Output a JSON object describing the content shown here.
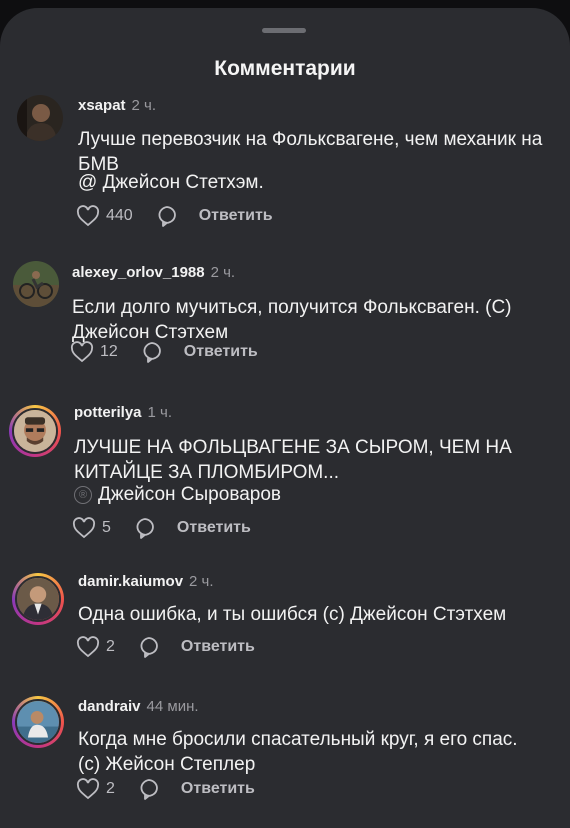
{
  "header": {
    "title": "Комментарии"
  },
  "comments": [
    {
      "username": "xsapat",
      "time": "2 ч.",
      "text": "Лучше перевозчик на Фольксвагене, чем механик на БМВ",
      "mention": "@ Джейсон Стетхэм.",
      "likes": "440",
      "reply": "Ответить"
    },
    {
      "username": "alexey_orlov_1988",
      "time": "2 ч.",
      "text": "Если долго мучиться, получится Фольксваген. (С) Джейсон Стэтхем",
      "likes": "12",
      "reply": "Ответить"
    },
    {
      "username": "potterilya",
      "time": "1 ч.",
      "text": "ЛУЧШЕ НА ФОЛЬЦВАГЕНЕ ЗА СЫРОМ, ЧЕМ НА КИТАЙЦЕ ЗА ПЛОМБИРОМ...",
      "mention": "Джейсон Сыроваров",
      "mention_symbol": "®",
      "likes": "5",
      "reply": "Ответить"
    },
    {
      "username": "damir.kaiumov",
      "time": "2 ч.",
      "text": "Одна ошибка, и ты ошибся (с) Джейсон Стэтхем",
      "likes": "2",
      "reply": "Ответить"
    },
    {
      "username": "dandraiv",
      "time": "44 мин.",
      "text": "Когда мне бросили спасательный круг, я его спас. (с) Жейсон Степлер",
      "likes": "2",
      "reply": "Ответить"
    }
  ]
}
